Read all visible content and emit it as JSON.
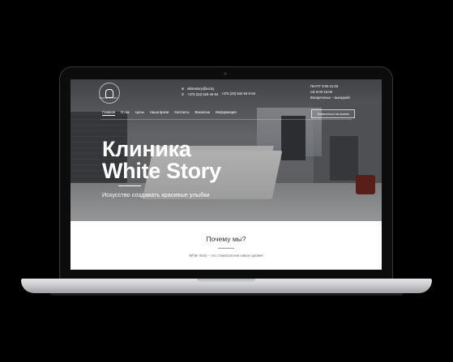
{
  "header": {
    "logo_text": "WHITE STORY",
    "email": "whitestory@tut.by",
    "phone_1": "+375 (33) 629-40-94",
    "phone_2": "+375 (29) 632-94-0-94",
    "hours": [
      "ПН-ПТ 9:00-21:00",
      "СБ 9:00-15:00",
      "Воскресенье – выходной"
    ],
    "cta_label": "Записаться на прием"
  },
  "nav": {
    "items": [
      "Главная",
      "О нас",
      "Цены",
      "Наши врачи",
      "Контакты",
      "Вакансии",
      "Информация"
    ]
  },
  "hero": {
    "title_line1": "Клиника",
    "title_line2": "White Story",
    "subtitle": "Искусство создавать красивые улыбки"
  },
  "why": {
    "title": "Почему мы?",
    "text": "White Story – это стоматология нового уровня"
  },
  "colors": {
    "laptop_base": "#cfd0d2",
    "bezel": "#0c0c0d"
  }
}
